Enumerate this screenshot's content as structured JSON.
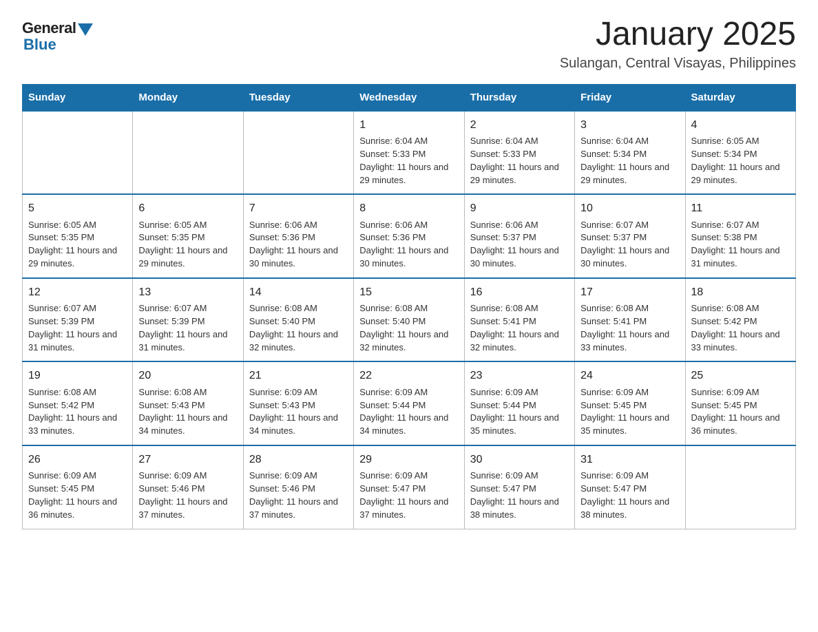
{
  "logo": {
    "general": "General",
    "blue": "Blue"
  },
  "title": "January 2025",
  "subtitle": "Sulangan, Central Visayas, Philippines",
  "weekdays": [
    "Sunday",
    "Monday",
    "Tuesday",
    "Wednesday",
    "Thursday",
    "Friday",
    "Saturday"
  ],
  "weeks": [
    [
      {
        "day": "",
        "info": ""
      },
      {
        "day": "",
        "info": ""
      },
      {
        "day": "",
        "info": ""
      },
      {
        "day": "1",
        "info": "Sunrise: 6:04 AM\nSunset: 5:33 PM\nDaylight: 11 hours and 29 minutes."
      },
      {
        "day": "2",
        "info": "Sunrise: 6:04 AM\nSunset: 5:33 PM\nDaylight: 11 hours and 29 minutes."
      },
      {
        "day": "3",
        "info": "Sunrise: 6:04 AM\nSunset: 5:34 PM\nDaylight: 11 hours and 29 minutes."
      },
      {
        "day": "4",
        "info": "Sunrise: 6:05 AM\nSunset: 5:34 PM\nDaylight: 11 hours and 29 minutes."
      }
    ],
    [
      {
        "day": "5",
        "info": "Sunrise: 6:05 AM\nSunset: 5:35 PM\nDaylight: 11 hours and 29 minutes."
      },
      {
        "day": "6",
        "info": "Sunrise: 6:05 AM\nSunset: 5:35 PM\nDaylight: 11 hours and 29 minutes."
      },
      {
        "day": "7",
        "info": "Sunrise: 6:06 AM\nSunset: 5:36 PM\nDaylight: 11 hours and 30 minutes."
      },
      {
        "day": "8",
        "info": "Sunrise: 6:06 AM\nSunset: 5:36 PM\nDaylight: 11 hours and 30 minutes."
      },
      {
        "day": "9",
        "info": "Sunrise: 6:06 AM\nSunset: 5:37 PM\nDaylight: 11 hours and 30 minutes."
      },
      {
        "day": "10",
        "info": "Sunrise: 6:07 AM\nSunset: 5:37 PM\nDaylight: 11 hours and 30 minutes."
      },
      {
        "day": "11",
        "info": "Sunrise: 6:07 AM\nSunset: 5:38 PM\nDaylight: 11 hours and 31 minutes."
      }
    ],
    [
      {
        "day": "12",
        "info": "Sunrise: 6:07 AM\nSunset: 5:39 PM\nDaylight: 11 hours and 31 minutes."
      },
      {
        "day": "13",
        "info": "Sunrise: 6:07 AM\nSunset: 5:39 PM\nDaylight: 11 hours and 31 minutes."
      },
      {
        "day": "14",
        "info": "Sunrise: 6:08 AM\nSunset: 5:40 PM\nDaylight: 11 hours and 32 minutes."
      },
      {
        "day": "15",
        "info": "Sunrise: 6:08 AM\nSunset: 5:40 PM\nDaylight: 11 hours and 32 minutes."
      },
      {
        "day": "16",
        "info": "Sunrise: 6:08 AM\nSunset: 5:41 PM\nDaylight: 11 hours and 32 minutes."
      },
      {
        "day": "17",
        "info": "Sunrise: 6:08 AM\nSunset: 5:41 PM\nDaylight: 11 hours and 33 minutes."
      },
      {
        "day": "18",
        "info": "Sunrise: 6:08 AM\nSunset: 5:42 PM\nDaylight: 11 hours and 33 minutes."
      }
    ],
    [
      {
        "day": "19",
        "info": "Sunrise: 6:08 AM\nSunset: 5:42 PM\nDaylight: 11 hours and 33 minutes."
      },
      {
        "day": "20",
        "info": "Sunrise: 6:08 AM\nSunset: 5:43 PM\nDaylight: 11 hours and 34 minutes."
      },
      {
        "day": "21",
        "info": "Sunrise: 6:09 AM\nSunset: 5:43 PM\nDaylight: 11 hours and 34 minutes."
      },
      {
        "day": "22",
        "info": "Sunrise: 6:09 AM\nSunset: 5:44 PM\nDaylight: 11 hours and 34 minutes."
      },
      {
        "day": "23",
        "info": "Sunrise: 6:09 AM\nSunset: 5:44 PM\nDaylight: 11 hours and 35 minutes."
      },
      {
        "day": "24",
        "info": "Sunrise: 6:09 AM\nSunset: 5:45 PM\nDaylight: 11 hours and 35 minutes."
      },
      {
        "day": "25",
        "info": "Sunrise: 6:09 AM\nSunset: 5:45 PM\nDaylight: 11 hours and 36 minutes."
      }
    ],
    [
      {
        "day": "26",
        "info": "Sunrise: 6:09 AM\nSunset: 5:45 PM\nDaylight: 11 hours and 36 minutes."
      },
      {
        "day": "27",
        "info": "Sunrise: 6:09 AM\nSunset: 5:46 PM\nDaylight: 11 hours and 37 minutes."
      },
      {
        "day": "28",
        "info": "Sunrise: 6:09 AM\nSunset: 5:46 PM\nDaylight: 11 hours and 37 minutes."
      },
      {
        "day": "29",
        "info": "Sunrise: 6:09 AM\nSunset: 5:47 PM\nDaylight: 11 hours and 37 minutes."
      },
      {
        "day": "30",
        "info": "Sunrise: 6:09 AM\nSunset: 5:47 PM\nDaylight: 11 hours and 38 minutes."
      },
      {
        "day": "31",
        "info": "Sunrise: 6:09 AM\nSunset: 5:47 PM\nDaylight: 11 hours and 38 minutes."
      },
      {
        "day": "",
        "info": ""
      }
    ]
  ]
}
